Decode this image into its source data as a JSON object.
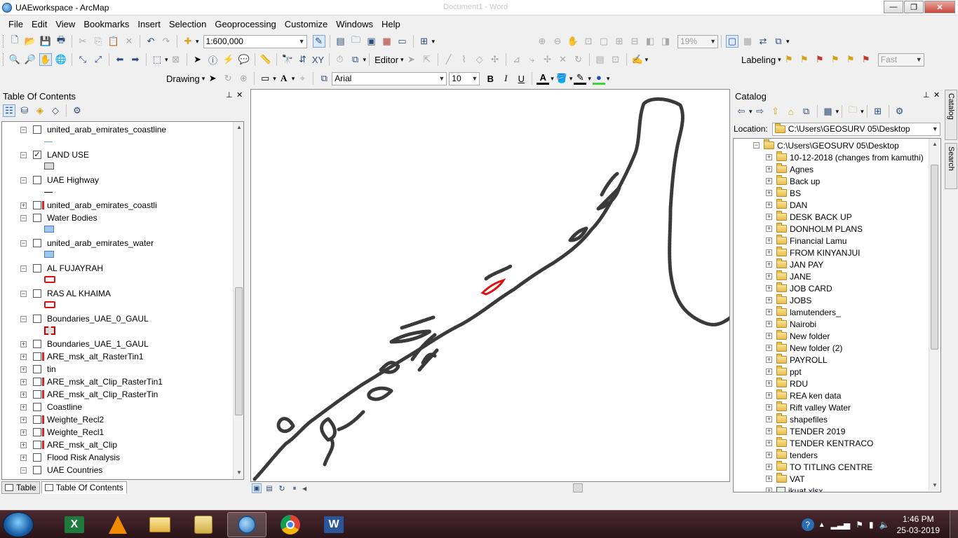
{
  "window": {
    "title": "UAEworkspace - ArcMap",
    "ghost_title": "Document1 - Word",
    "controls": [
      "—",
      "❐",
      "✕"
    ]
  },
  "menu": [
    "File",
    "Edit",
    "View",
    "Bookmarks",
    "Insert",
    "Selection",
    "Geoprocessing",
    "Customize",
    "Windows",
    "Help"
  ],
  "toolbar": {
    "scale": "1:600,000",
    "zoom_percent": "19%",
    "editor_label": "Editor",
    "labeling_label": "Labeling",
    "label_quality": "Fast",
    "drawing_label": "Drawing",
    "font_name": "Arial",
    "font_size": "10",
    "bold": "B",
    "italic": "I",
    "underline": "U",
    "text_tool": "A"
  },
  "toc": {
    "title": "Table Of Contents",
    "pin": "ᵖ",
    "close": "✕",
    "layers": [
      {
        "name": "united_arab_emirates_coastline",
        "expander": "−",
        "checked": false,
        "broken": false,
        "symbol": "line-blue"
      },
      {
        "name": "LAND USE",
        "expander": "−",
        "checked": true,
        "broken": false,
        "symbol": "fill-gray"
      },
      {
        "name": "UAE Highway",
        "expander": "−",
        "checked": false,
        "broken": false,
        "symbol": "line-black"
      },
      {
        "name": "united_arab_emirates_coastli",
        "expander": "+",
        "checked": false,
        "broken": true,
        "symbol": ""
      },
      {
        "name": "Water Bodies",
        "expander": "−",
        "checked": false,
        "broken": false,
        "symbol": "fill-blue"
      },
      {
        "name": "united_arab_emirates_water",
        "expander": "−",
        "checked": false,
        "broken": false,
        "symbol": "fill-blue"
      },
      {
        "name": "AL FUJAYRAH",
        "expander": "−",
        "checked": false,
        "broken": false,
        "symbol": "red"
      },
      {
        "name": "RAS AL KHAIMA",
        "expander": "−",
        "checked": false,
        "broken": false,
        "symbol": "red"
      },
      {
        "name": "Boundaries_UAE_0_GAUL",
        "expander": "−",
        "checked": false,
        "broken": false,
        "symbol": "red-dashed"
      },
      {
        "name": "Boundaries_UAE_1_GAUL",
        "expander": "+",
        "checked": false,
        "broken": false,
        "symbol": ""
      },
      {
        "name": "ARE_msk_alt_RasterTin1",
        "expander": "+",
        "checked": false,
        "broken": true,
        "symbol": ""
      },
      {
        "name": "tin",
        "expander": "+",
        "checked": false,
        "broken": false,
        "symbol": ""
      },
      {
        "name": "ARE_msk_alt_Clip_RasterTin1",
        "expander": "+",
        "checked": false,
        "broken": true,
        "symbol": ""
      },
      {
        "name": "ARE_msk_alt_Clip_RasterTin",
        "expander": "+",
        "checked": false,
        "broken": true,
        "symbol": ""
      },
      {
        "name": "Coastline",
        "expander": "+",
        "checked": false,
        "broken": false,
        "symbol": ""
      },
      {
        "name": "Weighte_Recl2",
        "expander": "+",
        "checked": false,
        "broken": true,
        "symbol": ""
      },
      {
        "name": "Weighte_Recl1",
        "expander": "+",
        "checked": false,
        "broken": true,
        "symbol": ""
      },
      {
        "name": "ARE_msk_alt_Clip",
        "expander": "+",
        "checked": false,
        "broken": true,
        "symbol": ""
      },
      {
        "name": "Flood Risk Analysis",
        "expander": "+",
        "checked": false,
        "broken": false,
        "symbol": ""
      },
      {
        "name": "UAE Countries",
        "expander": "−",
        "checked": false,
        "broken": false,
        "symbol": ""
      }
    ],
    "tabs": [
      "Table",
      "Table Of Contents"
    ]
  },
  "catalog": {
    "title": "Catalog",
    "location_label": "Location:",
    "location_value": "C:\\Users\\GEOSURV 05\\Desktop",
    "root": "C:\\Users\\GEOSURV 05\\Desktop",
    "folders": [
      "10-12-2018 (changes from kamuthi)",
      "Agnes",
      "Back up",
      "BS",
      "DAN",
      "DESK BACK UP",
      "DONHOLM PLANS",
      "Financial Lamu",
      "FROM KINYANJUI",
      "JAN PAY",
      "JANE",
      "JOB CARD",
      "JOBS",
      "lamutenders_",
      "Nairobi",
      "New folder",
      "New folder (2)",
      "PAYROLL",
      "ppt",
      "RDU",
      "REA ken data",
      "Rift valley Water",
      "shapefiles",
      "TENDER 2019",
      "TENDER KENTRACO",
      "tenders",
      "TO TITLING CENTRE",
      "VAT"
    ],
    "last_file": "ikuat.xlsx",
    "side_tabs": [
      "Catalog",
      "Search"
    ]
  },
  "taskbar": {
    "time": "1:46 PM",
    "date": "25-03-2019",
    "apps": [
      "excel-icon",
      "vlc-icon",
      "explorer-icon",
      "arccatalog-icon",
      "arcmap-icon",
      "chrome-icon",
      "word-icon"
    ]
  }
}
